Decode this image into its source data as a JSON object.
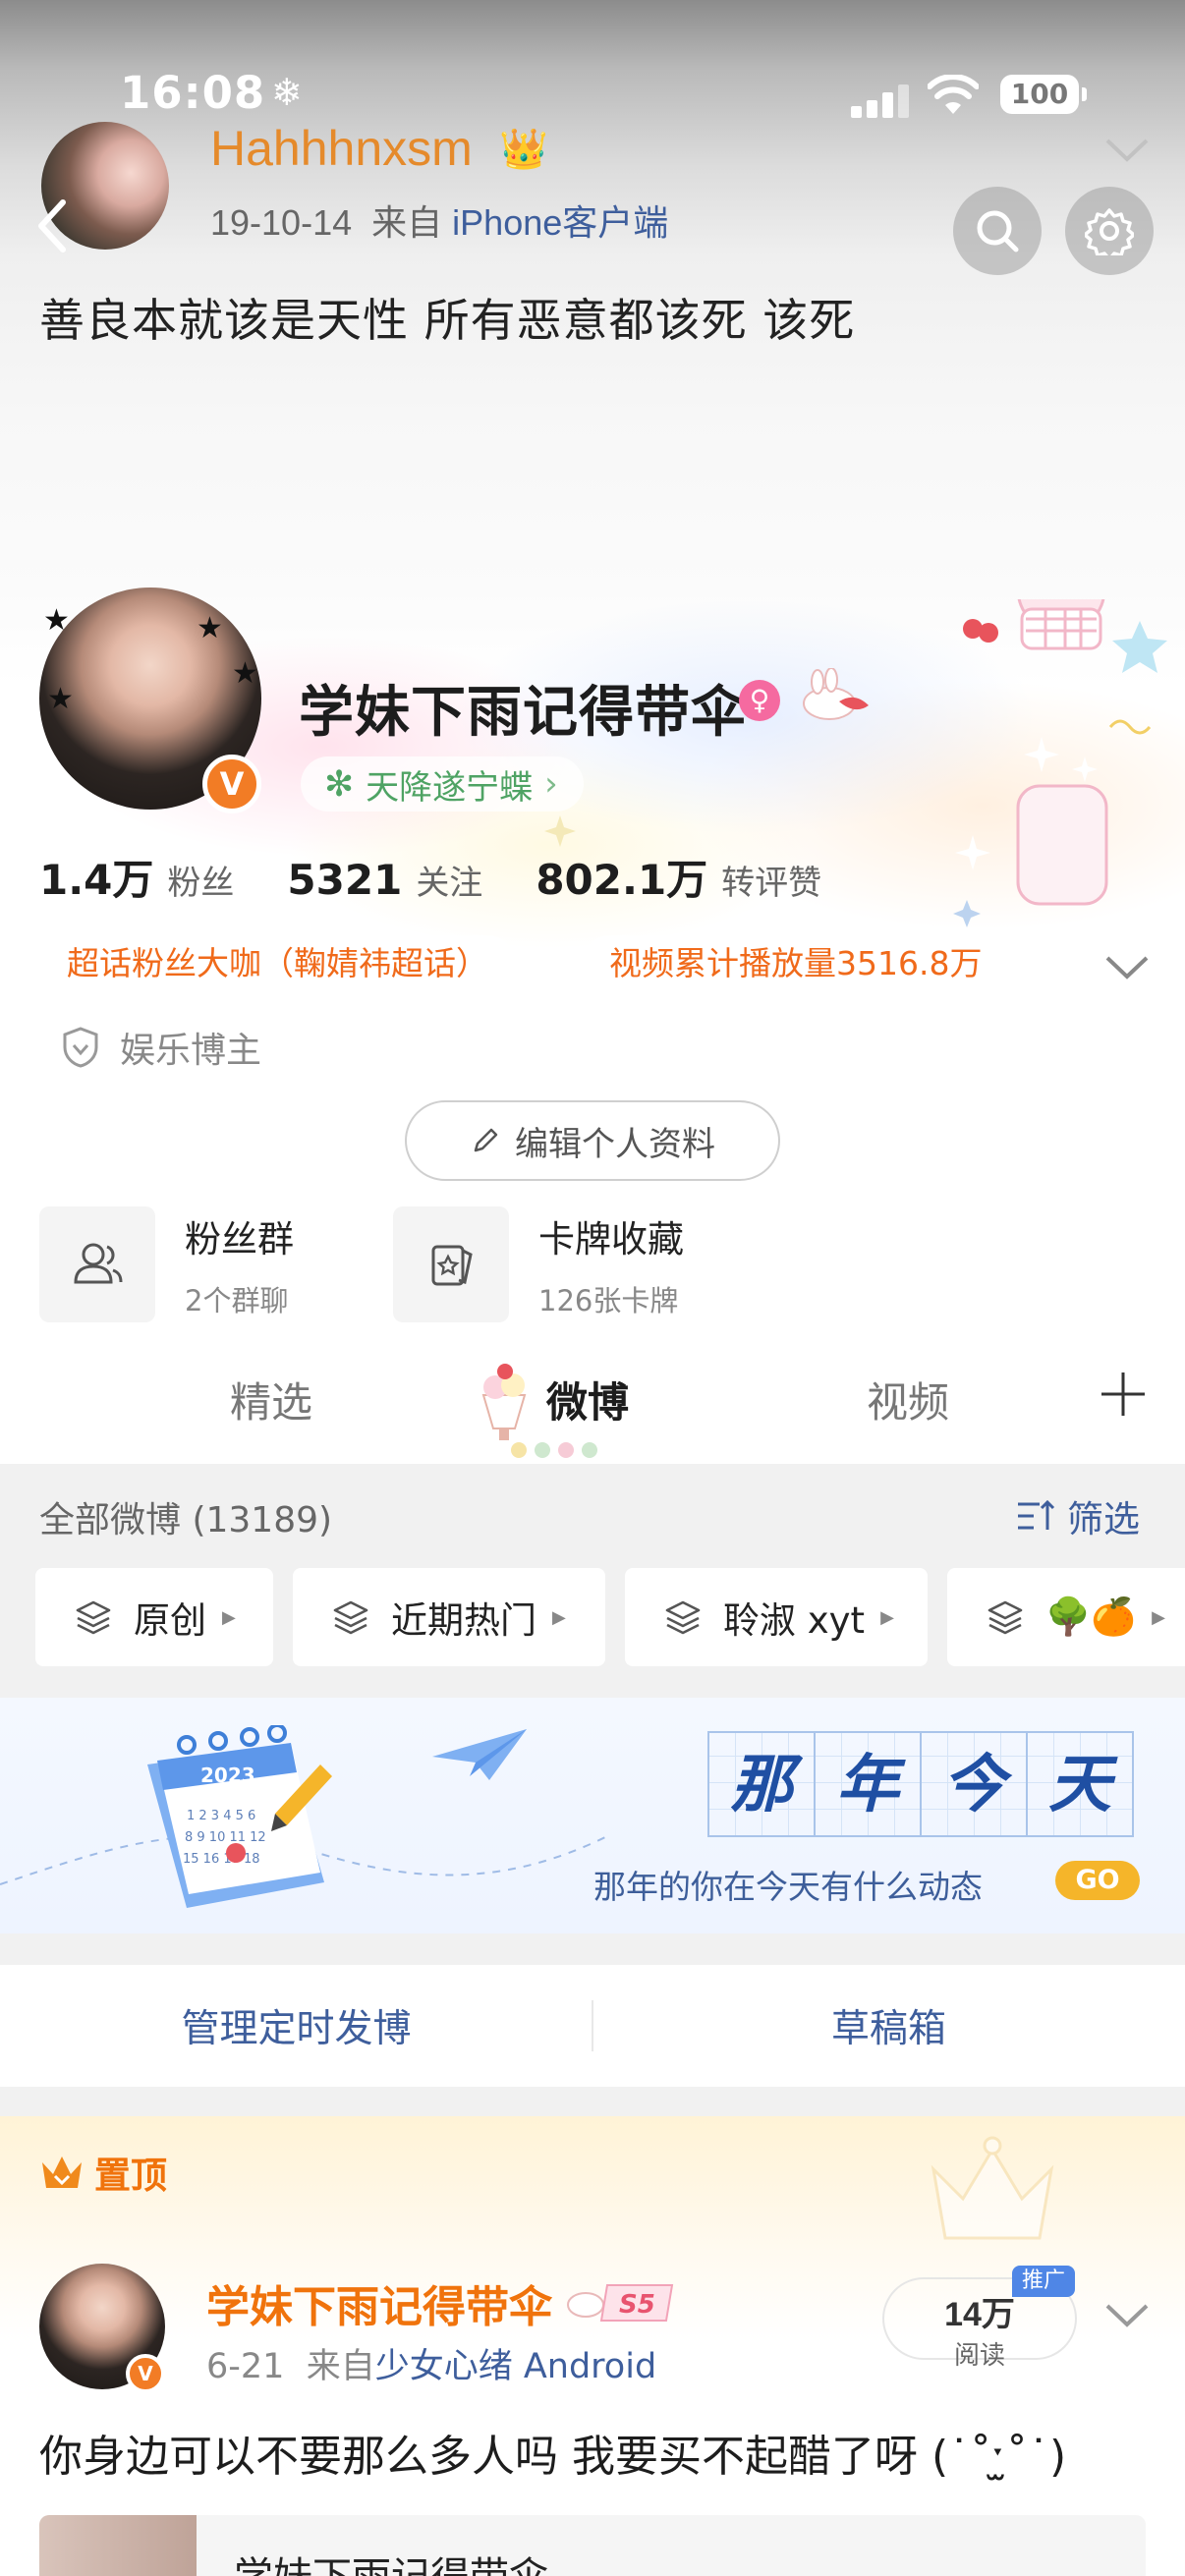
{
  "status_bar": {
    "time": "16:08",
    "battery": "100"
  },
  "previous_post": {
    "name": "Hahhhnxsm",
    "date": "19-10-14",
    "from_prefix": "来自",
    "source": "iPhone客户端"
  },
  "profile": {
    "bio": "善良本就该是天性  所有恶意都该死  该死",
    "name": "学妹下雨记得带伞",
    "medal": "天降遂宁蝶",
    "avatar_badge": "V",
    "stats": [
      {
        "value": "1.4万",
        "label": "粉丝"
      },
      {
        "value": "5321",
        "label": "关注"
      },
      {
        "value": "802.1万",
        "label": "转评赞"
      }
    ],
    "tags": [
      "超话粉丝大咖（鞠婧祎超话）",
      "视频累计播放量3516.8万"
    ],
    "verify": "娱乐博主",
    "edit_button": "编辑个人资料"
  },
  "quick_entries": [
    {
      "title": "粉丝群",
      "sub": "2个群聊",
      "icon": "people-icon"
    },
    {
      "title": "卡牌收藏",
      "sub": "126张卡牌",
      "icon": "card-icon"
    }
  ],
  "tabs": {
    "items": [
      "精选",
      "微博",
      "视频"
    ],
    "active": "微博"
  },
  "feed": {
    "all_count": "全部微博 (13189)",
    "filter": "筛选",
    "chips": [
      "原创",
      "近期热门",
      "聆淑 xyt",
      "🌳🍊"
    ]
  },
  "banner": {
    "chars": [
      "那",
      "年",
      "今",
      "天"
    ],
    "calendar_year": "2023",
    "subtitle": "那年的你在今天有什么动态",
    "go": "GO"
  },
  "manage": {
    "scheduled": "管理定时发博",
    "drafts": "草稿箱"
  },
  "pinned_post": {
    "pin_label": "置顶",
    "author": "学妹下雨记得带伞",
    "level_badge": "S5",
    "date": "6-21",
    "from_prefix": "来自",
    "source": "少女心绪 Android",
    "reads": "14万",
    "reads_label": "阅读",
    "promo": "推广",
    "text": "你身边可以不要那么多人吗 我要买不起醋了呀 (˙˚ˑ̫˚˙)",
    "embed_title": "学妹下雨记得带伞"
  },
  "colors": {
    "orange": "#f0730c",
    "link_blue": "#3e5e9c",
    "green": "#4fa364"
  }
}
